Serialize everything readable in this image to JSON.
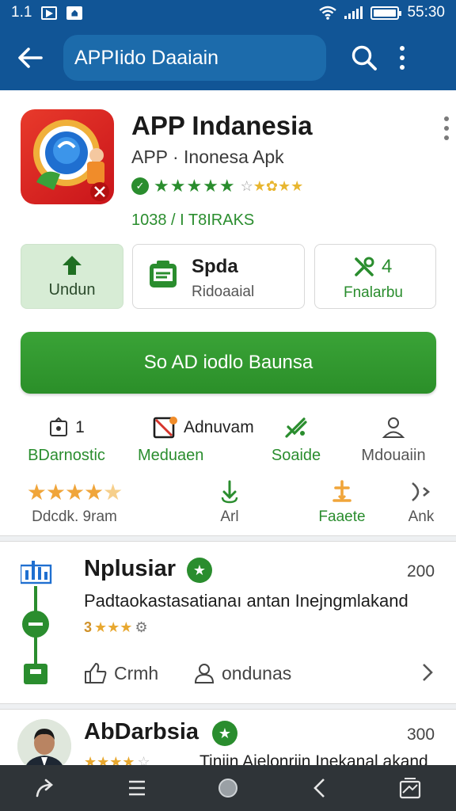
{
  "status_bar": {
    "left_time": "1.1",
    "right_time": "55:30"
  },
  "app_bar": {
    "search_text": "APPIido Daaiain"
  },
  "app": {
    "title": "APP Indanesia",
    "subtitle": "APP · Inonesa Apk",
    "meta": "1038 / I T8IRAKS",
    "rating_badge": "✓"
  },
  "actions": [
    {
      "label": "Undun"
    },
    {
      "title": "Spda",
      "label": "Ridoaaial"
    },
    {
      "count": "4",
      "label": "Fnalarbu"
    }
  ],
  "big_button": {
    "label": "So AD iodlo Baunsa"
  },
  "info_row": [
    {
      "top": "1",
      "bottom": "BDarnostic"
    },
    {
      "top": "Adnuvam",
      "bottom": "Meduaen"
    },
    {
      "top": "",
      "bottom": "Soaide"
    },
    {
      "top": "",
      "bottom": "Mdouaiin"
    }
  ],
  "rating_row": [
    {
      "bottom": "Ddcdk. 9ram"
    },
    {
      "bottom": "Arl"
    },
    {
      "bottom": "Faaete"
    },
    {
      "bottom": "Ank"
    }
  ],
  "reviews": [
    {
      "title": "Nplusiar",
      "count": "200",
      "text": "Padtaokastasatianaı antan Inejngmlakand",
      "rating_number": "3",
      "like_label": "Crmh",
      "user_label": "ondunas"
    },
    {
      "title": "AbDarbsia",
      "count": "300",
      "text": "Tiniin Aielonriin Inekanal akand"
    }
  ],
  "colors": {
    "primary_blue": "#115596",
    "accent_green": "#2a8d2e",
    "star_orange": "#f0a53a",
    "nav_dark": "#2f3438"
  }
}
